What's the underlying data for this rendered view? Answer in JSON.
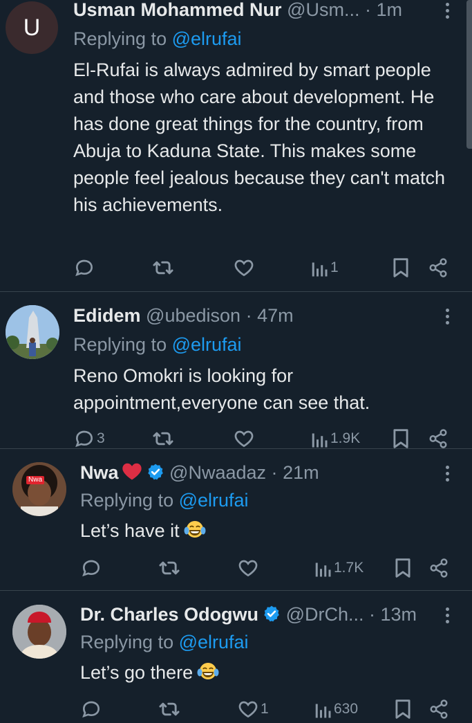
{
  "colors": {
    "background": "#15202b",
    "text": "#e7e9ea",
    "muted": "#8b98a5",
    "link": "#1d9bf0",
    "verified": "#1d9bf0",
    "heart": "#f91880",
    "divider": "#38444d"
  },
  "tweets": [
    {
      "avatar_letter": "U",
      "name": "Usman Mohammed Nur",
      "handle": "@Usm...",
      "separator": "·",
      "time": "1m",
      "replying_prefix": "Replying to ",
      "replying_handle": "@elrufai",
      "text": "El-Rufai is always admired by smart people and those who care about development. He has done great things for the country, from Abuja to Kaduna State. This makes some people feel jealous because they can't match his achievements.",
      "replies": "",
      "reposts": "",
      "likes": "",
      "views": "1"
    },
    {
      "name": "Edidem",
      "handle": "@ubedison",
      "separator": "·",
      "time": "47m",
      "replying_prefix": "Replying to ",
      "replying_handle": "@elrufai",
      "text": "Reno Omokri is looking for appointment,everyone can see that.",
      "replies": "3",
      "reposts": "",
      "likes": "",
      "views": "1.9K"
    },
    {
      "name": "Nwa",
      "name_emoji": "red-heart-emoji",
      "verified": true,
      "avatar_badge": "Nwa",
      "handle": "@Nwaadaz",
      "separator": "·",
      "time": "21m",
      "replying_prefix": "Replying to ",
      "replying_handle": "@elrufai",
      "text": "Let’s have it",
      "text_emoji": "laughing-tears-emoji",
      "replies": "",
      "reposts": "",
      "likes": "",
      "views": "1.7K"
    },
    {
      "name": "Dr. Charles Odogwu",
      "verified": true,
      "handle": "@DrCh...",
      "separator": "·",
      "time": "13m",
      "replying_prefix": "Replying to ",
      "replying_handle": "@elrufai",
      "text": "Let’s go there",
      "text_emoji": "laughing-tears-emoji",
      "replies": "",
      "reposts": "",
      "likes": "1",
      "views": "630"
    }
  ]
}
